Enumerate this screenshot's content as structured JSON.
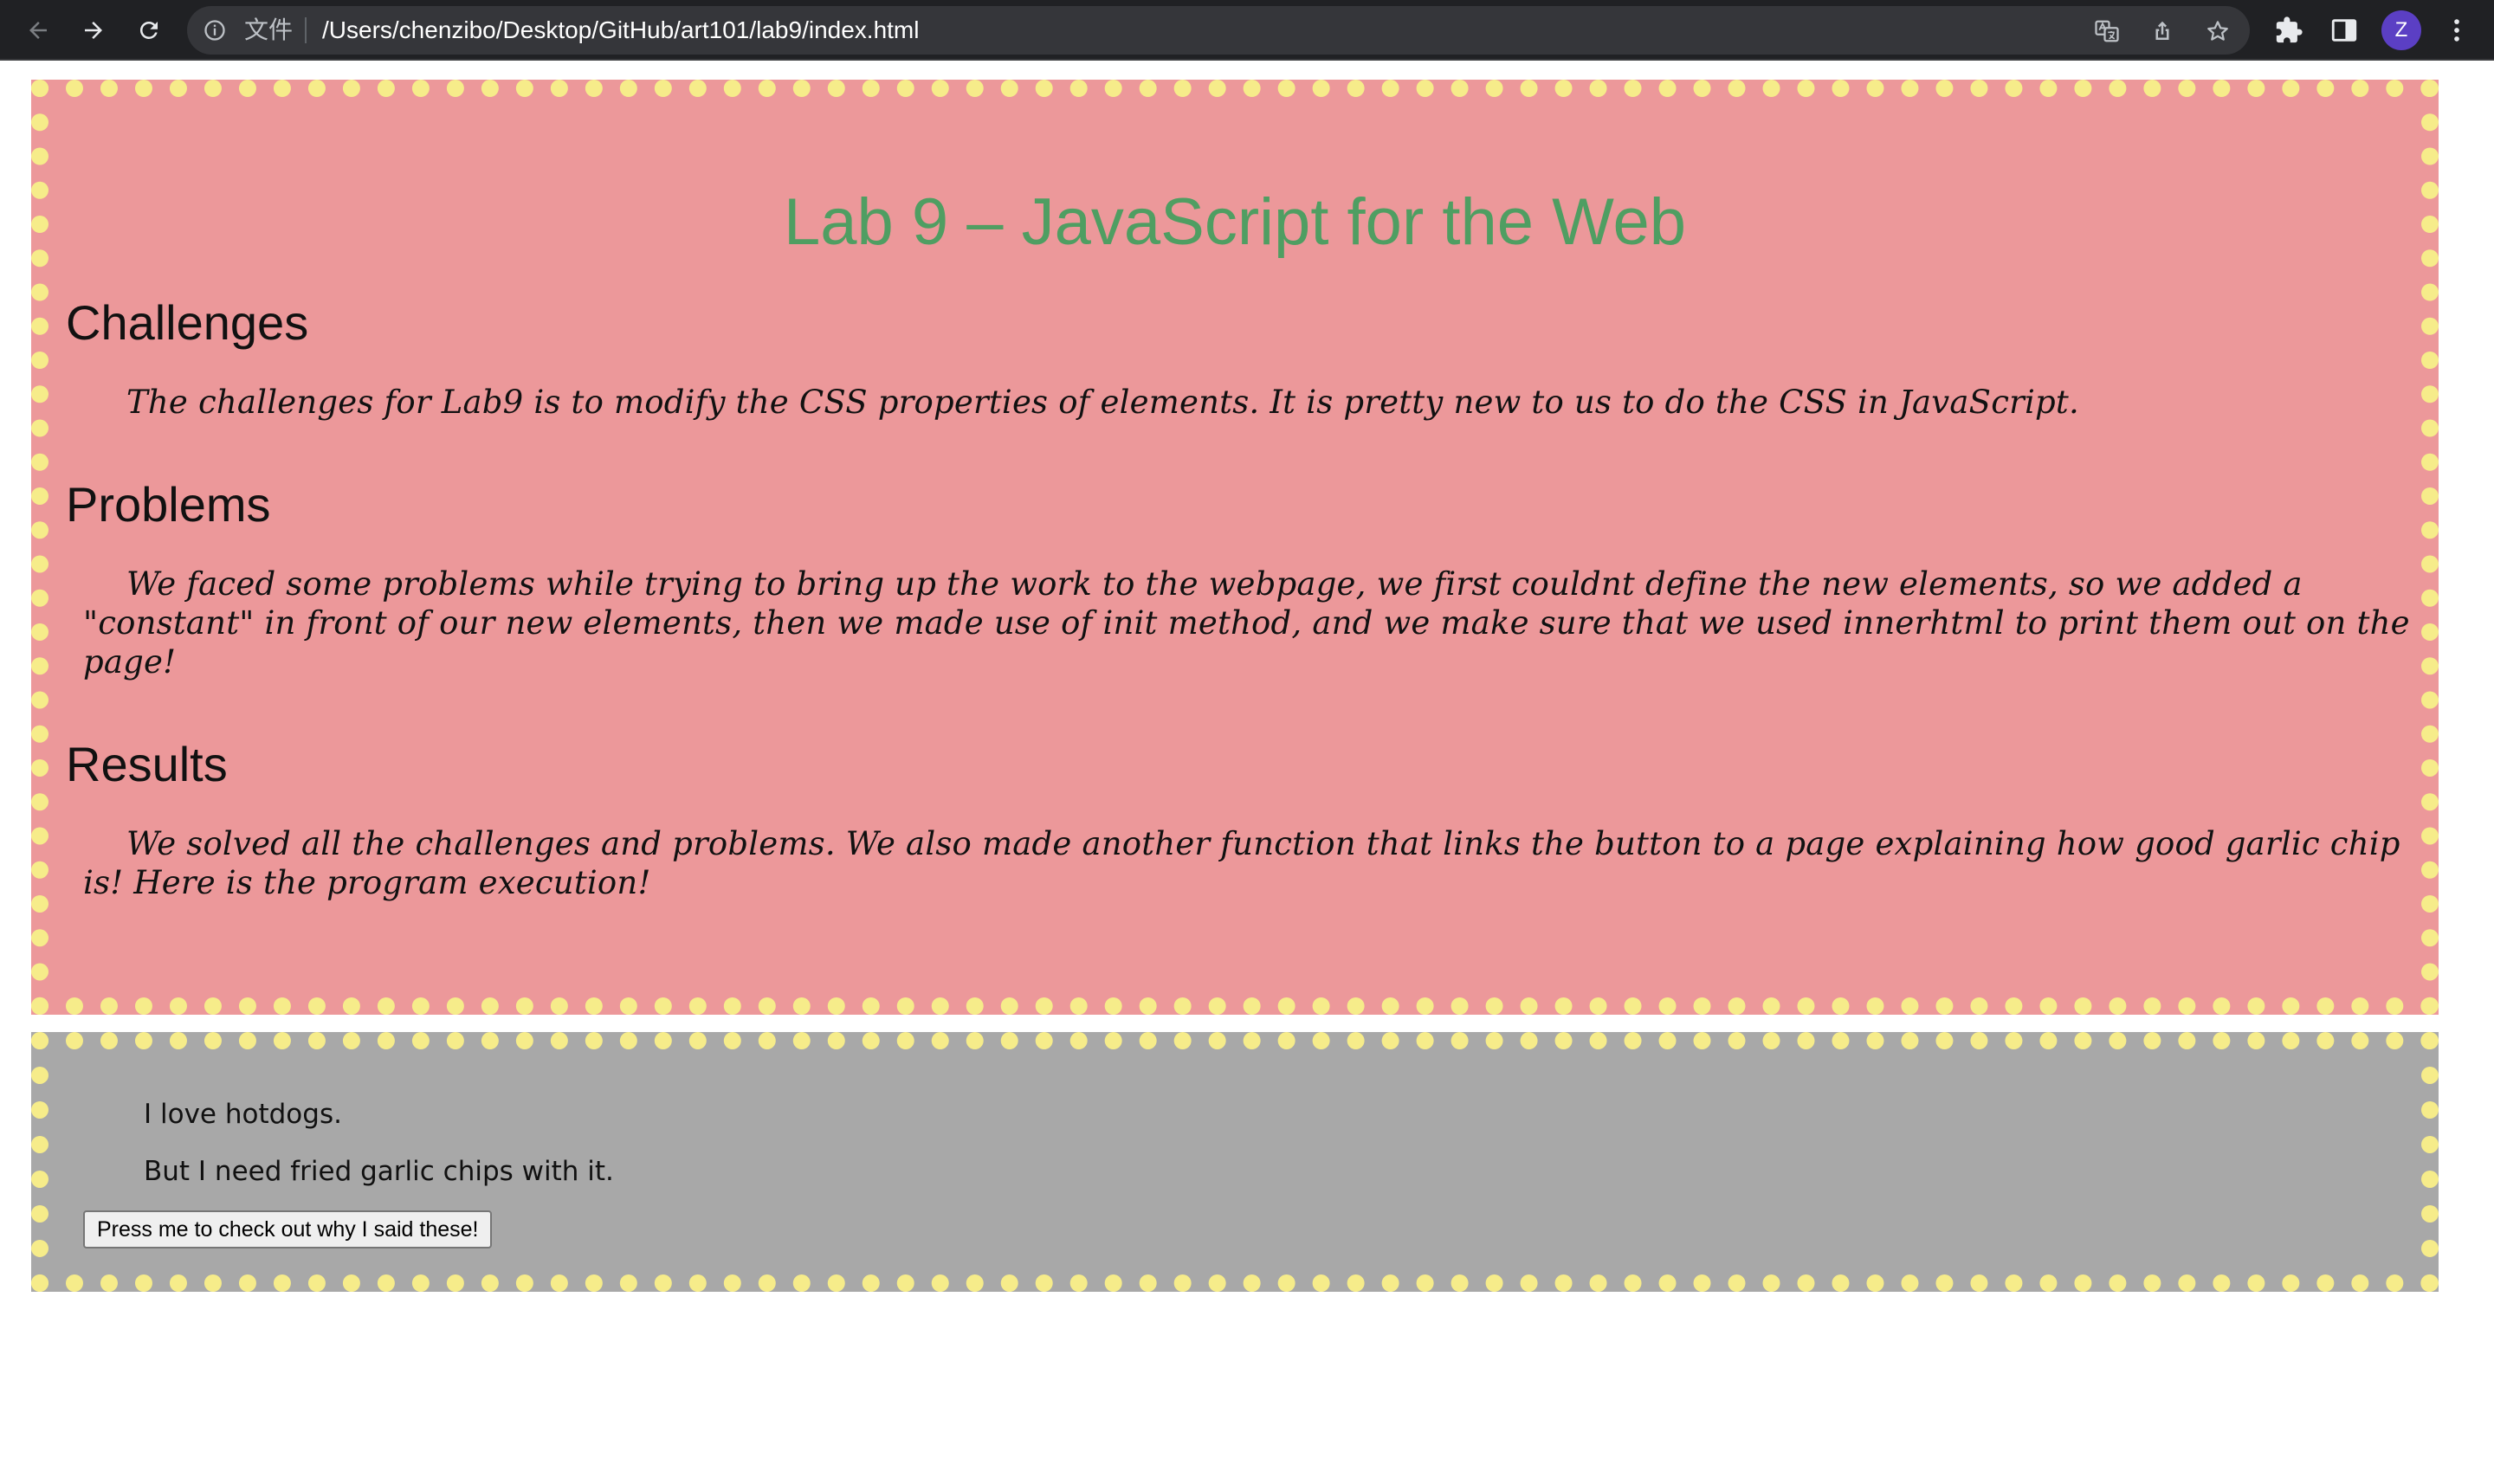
{
  "browser": {
    "scheme_label": "文件",
    "url": "/Users/chenzibo/Desktop/GitHub/art101/lab9/index.html",
    "avatar_letter": "Z",
    "avatar_color": "#5b3fc4",
    "icons": {
      "back": "arrow-left-icon",
      "forward": "arrow-right-icon",
      "reload": "reload-icon",
      "info": "info-icon",
      "translate": "translate-icon",
      "share": "share-icon",
      "bookmark": "star-icon",
      "extensions": "puzzle-icon",
      "side_panel": "side-panel-icon",
      "menu": "kebab-menu-icon"
    }
  },
  "page": {
    "title": "Lab 9 – JavaScript for the Web",
    "title_color": "#4f9e62",
    "main_box_color": "#ec989a",
    "second_box_color": "#a8a8a8",
    "border_dot_color": "#f6ec8a",
    "sections": [
      {
        "heading": "Challenges",
        "text": "The challenges for Lab9 is to modify the CSS properties of elements. It is pretty new to us to do the CSS in JavaScript."
      },
      {
        "heading": "Problems",
        "text": "We faced some problems while trying to bring up the work to the webpage, we first couldnt define the new elements, so we added a \"constant\" in front of our new elements, then we made use of init method, and we make sure that we used innerhtml to print them out on the page!"
      },
      {
        "heading": "Results",
        "text": "We solved all the challenges and problems. We also made another function that links the button to a page explaining how good garlic chip is! Here is the program execution!"
      }
    ],
    "output": {
      "line1": "I love hotdogs.",
      "line2": "But I need fried garlic chips with it.",
      "button_label": "Press me to check out why I said these!"
    }
  }
}
